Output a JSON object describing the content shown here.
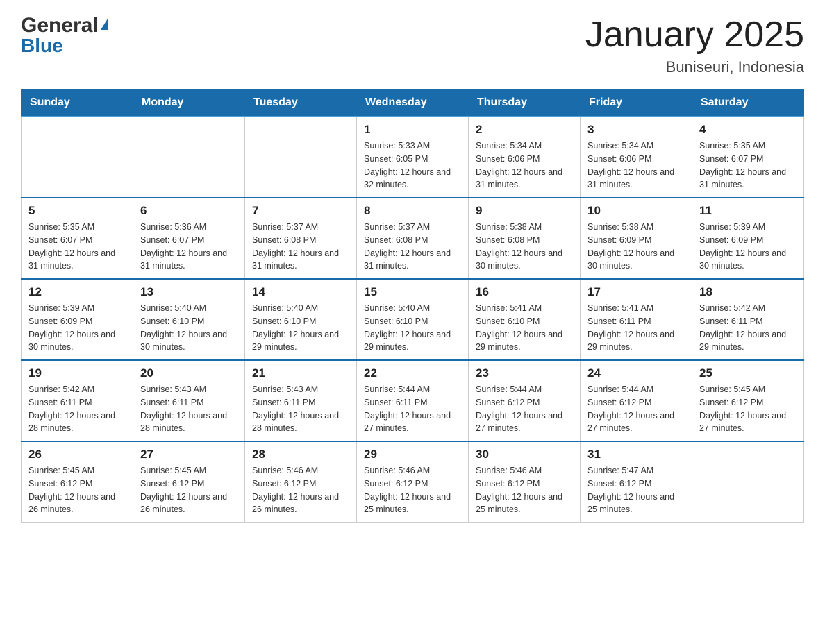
{
  "header": {
    "logo": {
      "general": "General",
      "blue": "Blue",
      "arrow_symbol": "▲"
    },
    "title": "January 2025",
    "subtitle": "Buniseuri, Indonesia"
  },
  "weekdays": [
    "Sunday",
    "Monday",
    "Tuesday",
    "Wednesday",
    "Thursday",
    "Friday",
    "Saturday"
  ],
  "weeks": [
    [
      {
        "day": "",
        "info": ""
      },
      {
        "day": "",
        "info": ""
      },
      {
        "day": "",
        "info": ""
      },
      {
        "day": "1",
        "info": "Sunrise: 5:33 AM\nSunset: 6:05 PM\nDaylight: 12 hours and 32 minutes."
      },
      {
        "day": "2",
        "info": "Sunrise: 5:34 AM\nSunset: 6:06 PM\nDaylight: 12 hours and 31 minutes."
      },
      {
        "day": "3",
        "info": "Sunrise: 5:34 AM\nSunset: 6:06 PM\nDaylight: 12 hours and 31 minutes."
      },
      {
        "day": "4",
        "info": "Sunrise: 5:35 AM\nSunset: 6:07 PM\nDaylight: 12 hours and 31 minutes."
      }
    ],
    [
      {
        "day": "5",
        "info": "Sunrise: 5:35 AM\nSunset: 6:07 PM\nDaylight: 12 hours and 31 minutes."
      },
      {
        "day": "6",
        "info": "Sunrise: 5:36 AM\nSunset: 6:07 PM\nDaylight: 12 hours and 31 minutes."
      },
      {
        "day": "7",
        "info": "Sunrise: 5:37 AM\nSunset: 6:08 PM\nDaylight: 12 hours and 31 minutes."
      },
      {
        "day": "8",
        "info": "Sunrise: 5:37 AM\nSunset: 6:08 PM\nDaylight: 12 hours and 31 minutes."
      },
      {
        "day": "9",
        "info": "Sunrise: 5:38 AM\nSunset: 6:08 PM\nDaylight: 12 hours and 30 minutes."
      },
      {
        "day": "10",
        "info": "Sunrise: 5:38 AM\nSunset: 6:09 PM\nDaylight: 12 hours and 30 minutes."
      },
      {
        "day": "11",
        "info": "Sunrise: 5:39 AM\nSunset: 6:09 PM\nDaylight: 12 hours and 30 minutes."
      }
    ],
    [
      {
        "day": "12",
        "info": "Sunrise: 5:39 AM\nSunset: 6:09 PM\nDaylight: 12 hours and 30 minutes."
      },
      {
        "day": "13",
        "info": "Sunrise: 5:40 AM\nSunset: 6:10 PM\nDaylight: 12 hours and 30 minutes."
      },
      {
        "day": "14",
        "info": "Sunrise: 5:40 AM\nSunset: 6:10 PM\nDaylight: 12 hours and 29 minutes."
      },
      {
        "day": "15",
        "info": "Sunrise: 5:40 AM\nSunset: 6:10 PM\nDaylight: 12 hours and 29 minutes."
      },
      {
        "day": "16",
        "info": "Sunrise: 5:41 AM\nSunset: 6:10 PM\nDaylight: 12 hours and 29 minutes."
      },
      {
        "day": "17",
        "info": "Sunrise: 5:41 AM\nSunset: 6:11 PM\nDaylight: 12 hours and 29 minutes."
      },
      {
        "day": "18",
        "info": "Sunrise: 5:42 AM\nSunset: 6:11 PM\nDaylight: 12 hours and 29 minutes."
      }
    ],
    [
      {
        "day": "19",
        "info": "Sunrise: 5:42 AM\nSunset: 6:11 PM\nDaylight: 12 hours and 28 minutes."
      },
      {
        "day": "20",
        "info": "Sunrise: 5:43 AM\nSunset: 6:11 PM\nDaylight: 12 hours and 28 minutes."
      },
      {
        "day": "21",
        "info": "Sunrise: 5:43 AM\nSunset: 6:11 PM\nDaylight: 12 hours and 28 minutes."
      },
      {
        "day": "22",
        "info": "Sunrise: 5:44 AM\nSunset: 6:11 PM\nDaylight: 12 hours and 27 minutes."
      },
      {
        "day": "23",
        "info": "Sunrise: 5:44 AM\nSunset: 6:12 PM\nDaylight: 12 hours and 27 minutes."
      },
      {
        "day": "24",
        "info": "Sunrise: 5:44 AM\nSunset: 6:12 PM\nDaylight: 12 hours and 27 minutes."
      },
      {
        "day": "25",
        "info": "Sunrise: 5:45 AM\nSunset: 6:12 PM\nDaylight: 12 hours and 27 minutes."
      }
    ],
    [
      {
        "day": "26",
        "info": "Sunrise: 5:45 AM\nSunset: 6:12 PM\nDaylight: 12 hours and 26 minutes."
      },
      {
        "day": "27",
        "info": "Sunrise: 5:45 AM\nSunset: 6:12 PM\nDaylight: 12 hours and 26 minutes."
      },
      {
        "day": "28",
        "info": "Sunrise: 5:46 AM\nSunset: 6:12 PM\nDaylight: 12 hours and 26 minutes."
      },
      {
        "day": "29",
        "info": "Sunrise: 5:46 AM\nSunset: 6:12 PM\nDaylight: 12 hours and 25 minutes."
      },
      {
        "day": "30",
        "info": "Sunrise: 5:46 AM\nSunset: 6:12 PM\nDaylight: 12 hours and 25 minutes."
      },
      {
        "day": "31",
        "info": "Sunrise: 5:47 AM\nSunset: 6:12 PM\nDaylight: 12 hours and 25 minutes."
      },
      {
        "day": "",
        "info": ""
      }
    ]
  ]
}
